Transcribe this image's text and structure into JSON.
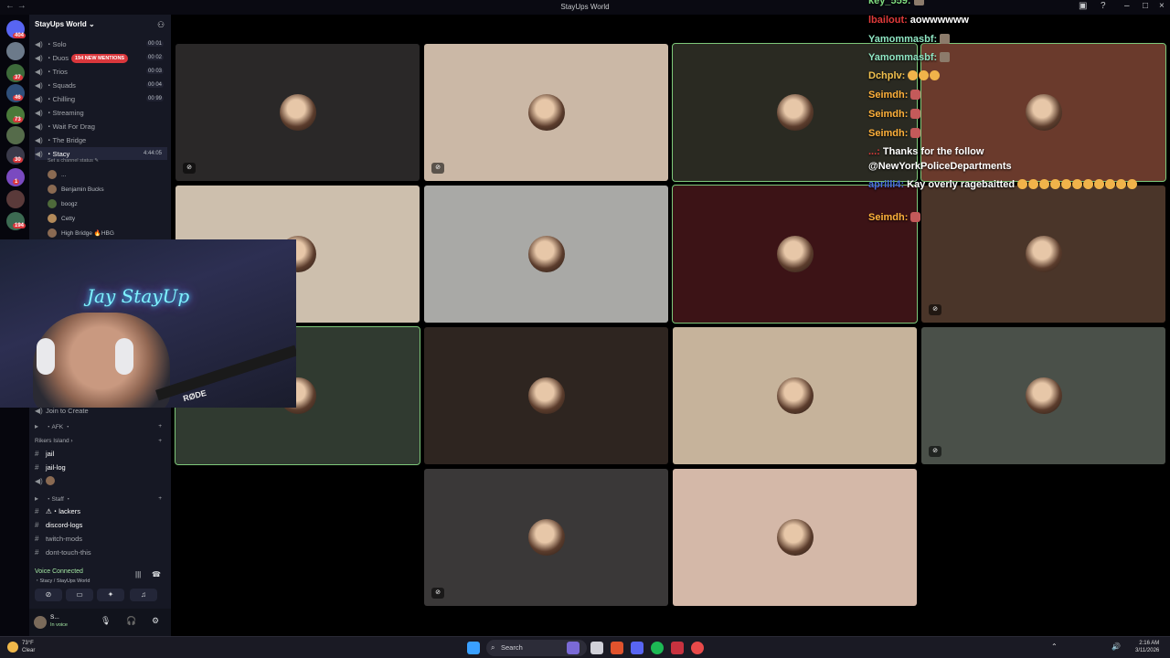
{
  "window": {
    "title": "StayUps World",
    "nav": "← →"
  },
  "rail": {
    "home_badge": "404",
    "badges": [
      "37",
      "46",
      "73",
      "30",
      "1",
      "194",
      "1"
    ]
  },
  "sidebar": {
    "guild_name": "StayUps World ⌄",
    "mentions": "194 NEW MENTIONS",
    "channels": [
      {
        "name": "・Solo",
        "count": "00 01"
      },
      {
        "name": "・Duos",
        "count": "00 02"
      },
      {
        "name": "・Trios",
        "count": "00 03"
      },
      {
        "name": "・Squads",
        "count": "00 04"
      },
      {
        "name": "・Chilling",
        "count": "00 99"
      },
      {
        "name": "・Streaming",
        "count": ""
      },
      {
        "name": "・Wait For Drag",
        "count": ""
      },
      {
        "name": "・The Bridge",
        "count": ""
      },
      {
        "name": "・Stacy",
        "count": "4:44:05"
      }
    ],
    "status_hint": "Set a channel status ✎",
    "members": [
      {
        "name": "..."
      },
      {
        "name": "Benjamin Bucks"
      },
      {
        "name": "boogz"
      },
      {
        "name": "Cetty"
      },
      {
        "name": "High Bridge 🔥HBG"
      }
    ],
    "lower": [
      {
        "name": "Join to Create",
        "kind": "voice"
      },
      {
        "name": "・AFK ・",
        "kind": "category"
      },
      {
        "name": "Rikers Island ›",
        "kind": "category"
      },
      {
        "name": "jail",
        "kind": "text"
      },
      {
        "name": "jail-log",
        "kind": "text"
      },
      {
        "name": "・Staff ・",
        "kind": "category"
      },
      {
        "name": "⚠・lackers",
        "kind": "text"
      },
      {
        "name": "discord-logs",
        "kind": "text"
      },
      {
        "name": "twitch-mods",
        "kind": "text"
      },
      {
        "name": "dont-touch-this",
        "kind": "text"
      }
    ],
    "voice": {
      "title": "Voice Connected",
      "subtitle": "・Stacy / StayUps World"
    },
    "user": {
      "name": "S...",
      "status": "In voice"
    }
  },
  "webcam": {
    "neon_text": "Jay StayUp",
    "mic_brand": "RØDE"
  },
  "chat": {
    "messages": [
      {
        "user": "key_559:",
        "color": "#7fdc7f",
        "text": "",
        "emotes": [
          "face"
        ]
      },
      {
        "user": "lbailout:",
        "color": "#e03a3a",
        "text": "aowwwwww",
        "emotes": []
      },
      {
        "user": "Yamommasbf:",
        "color": "#8fe6c3",
        "text": "",
        "emotes": [
          "face"
        ]
      },
      {
        "user": "Yamommasbf:",
        "color": "#8fe6c3",
        "text": "",
        "emotes": [
          "face"
        ]
      },
      {
        "user": "Dchplv:",
        "color": "#f2c14e",
        "text": "",
        "emotes": [
          "smile",
          "smile",
          "smile"
        ]
      },
      {
        "user": "Seimdh:",
        "color": "#ffb13b",
        "text": "",
        "emotes": [
          "mouth"
        ]
      },
      {
        "user": "Seimdh:",
        "color": "#ffb13b",
        "text": "",
        "emotes": [
          "mouth"
        ]
      },
      {
        "user": "Seimdh:",
        "color": "#ffb13b",
        "text": "",
        "emotes": [
          "mouth"
        ]
      },
      {
        "user": "...:",
        "color": "#e03a3a",
        "text": "Thanks for the follow",
        "emotes": []
      },
      {
        "user": "",
        "color": "#ffffff",
        "text": "@NewYorkPoliceDepartments",
        "emotes": []
      },
      {
        "user": "aprilli4:",
        "color": "#4a6fe0",
        "text": "Kay overly ragebaitted",
        "emotes": [
          "smile",
          "smile",
          "smile",
          "smile",
          "smile",
          "smile",
          "smile",
          "smile",
          "smile",
          "smile",
          "smile"
        ]
      },
      {
        "user": "Seimdh:",
        "color": "#ffb13b",
        "text": "",
        "emotes": [
          "mouth"
        ]
      }
    ]
  },
  "taskbar": {
    "weather_temp": "73°F",
    "weather_cond": "Clear",
    "search": "Search",
    "time": "2:16 AM",
    "date": "3/11/2026"
  },
  "tiles": [
    {
      "bg": "#2a2828",
      "speaking": false,
      "muted": true
    },
    {
      "bg": "#cbb8a6",
      "speaking": false,
      "muted": true
    },
    {
      "bg": "#2a2a22",
      "speaking": true,
      "muted": false
    },
    {
      "bg": "#6a3a2c",
      "speaking": true,
      "muted": false
    },
    {
      "bg": "#cdbfad",
      "speaking": false,
      "muted": false
    },
    {
      "bg": "#a9a9a6",
      "speaking": false,
      "muted": false
    },
    {
      "bg": "#3c1316",
      "speaking": true,
      "muted": false
    },
    {
      "bg": "#4a3529",
      "speaking": false,
      "muted": true
    },
    {
      "bg": "#303a30",
      "speaking": true,
      "muted": false
    },
    {
      "bg": "#2e2520",
      "speaking": false,
      "muted": false
    },
    {
      "bg": "#c6b39b",
      "speaking": false,
      "muted": false
    },
    {
      "bg": "#4a5049",
      "speaking": false,
      "muted": true
    },
    {
      "bg": "#3a3838",
      "speaking": false,
      "muted": true
    },
    {
      "bg": "#d4b8a8",
      "speaking": false,
      "muted": false
    }
  ]
}
